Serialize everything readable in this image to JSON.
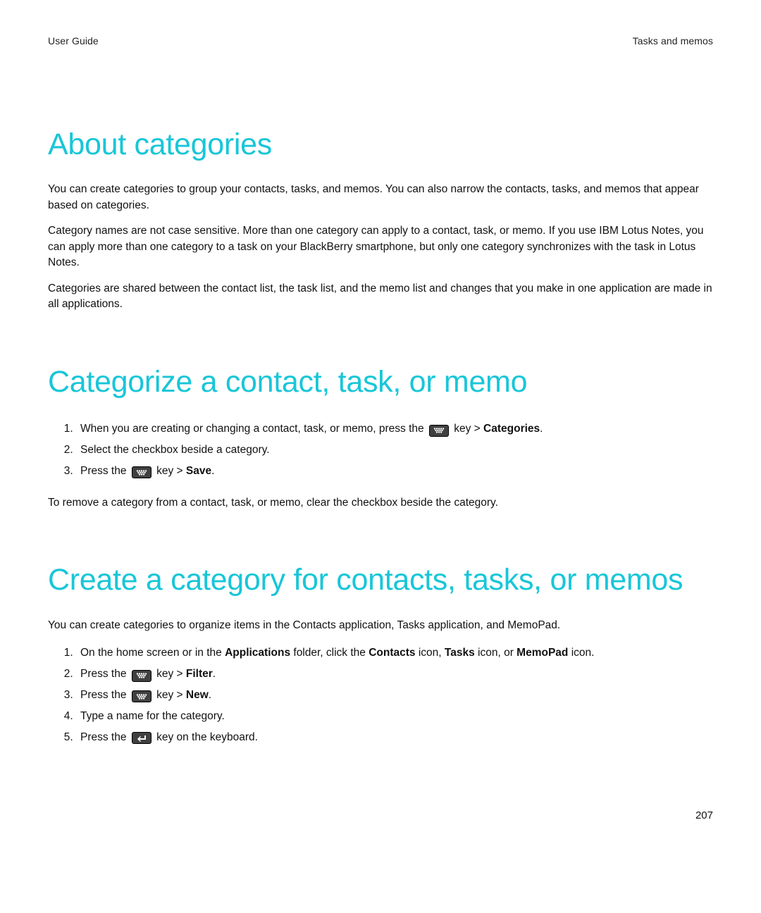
{
  "header": {
    "left": "User Guide",
    "right": "Tasks and memos"
  },
  "section1": {
    "heading": "About categories",
    "para1": "You can create categories to group your contacts, tasks, and memos. You can also narrow the contacts, tasks, and memos that appear based on categories.",
    "para2": "Category names are not case sensitive. More than one category can apply to a contact, task, or memo. If you use IBM Lotus Notes, you can apply more than one category to a task on your BlackBerry smartphone, but only one category synchronizes with the task in Lotus Notes.",
    "para3": "Categories are shared between the contact list, the task list, and the memo list and changes that you make in one application are made in all applications."
  },
  "section2": {
    "heading": "Categorize a contact, task, or memo",
    "step1_a": "When you are creating or changing a contact, task, or memo, press the ",
    "step1_b": " key > ",
    "step1_bold": "Categories",
    "step1_c": ".",
    "step2": "Select the checkbox beside a category.",
    "step3_a": "Press the ",
    "step3_b": " key > ",
    "step3_bold": "Save",
    "step3_c": ".",
    "footer": "To remove a category from a contact, task, or memo, clear the checkbox beside the category."
  },
  "section3": {
    "heading": "Create a category for contacts, tasks, or memos",
    "intro": "You can create categories to organize items in the Contacts application, Tasks application, and MemoPad.",
    "step1_a": "On the home screen or in the ",
    "step1_bold1": "Applications",
    "step1_b": " folder, click the ",
    "step1_bold2": "Contacts",
    "step1_c": " icon, ",
    "step1_bold3": "Tasks",
    "step1_d": " icon, or ",
    "step1_bold4": "MemoPad",
    "step1_e": " icon.",
    "step2_a": "Press the ",
    "step2_b": " key > ",
    "step2_bold": "Filter",
    "step2_c": ".",
    "step3_a": "Press the ",
    "step3_b": " key > ",
    "step3_bold": "New",
    "step3_c": ".",
    "step4": "Type a name for the category.",
    "step5_a": "Press the ",
    "step5_b": " key on the keyboard."
  },
  "page_number": "207"
}
